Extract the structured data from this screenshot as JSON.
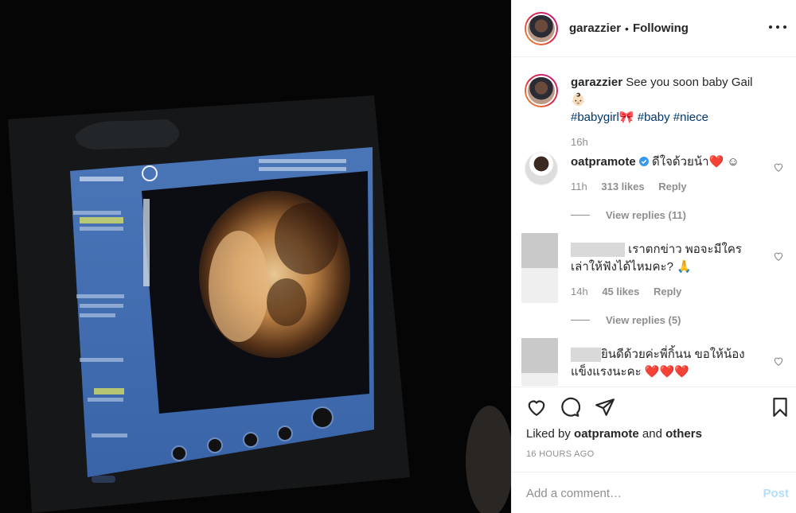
{
  "post": {
    "username": "garazzier",
    "separator": "•",
    "follow_status": "Following"
  },
  "caption": {
    "username": "garazzier",
    "text": "See you soon baby Gail",
    "emoji": "👶🏻",
    "hashtags": [
      "#babygirl",
      "🎀",
      "#baby",
      "#niece"
    ],
    "time": "16h"
  },
  "comments": [
    {
      "username": "oatpramote",
      "verified": true,
      "text": "ดีใจด้วยน้า",
      "emoji": "❤️ ☺",
      "time": "11h",
      "likes": "313 likes",
      "reply": "Reply",
      "view_replies": "View replies (11)"
    },
    {
      "username": "",
      "text_line1": "เราตกข่าว พอจะมีใคร",
      "text_line2": "เล่าให้ฟังได้ไหมคะ?",
      "emoji": "🙏",
      "time": "14h",
      "likes": "45 likes",
      "reply": "Reply",
      "view_replies": "View replies (5)"
    },
    {
      "username": "",
      "text_line1": "ยินดีด้วยค่ะพี่กิ้นน ขอให้น้อง",
      "text_line2": "แข็งแรงนะคะ",
      "emoji": "❤️❤️❤️"
    }
  ],
  "footer": {
    "liked_prefix": "Liked by",
    "liked_user": "oatpramote",
    "liked_and": "and",
    "liked_others": "others",
    "timestamp": "16 HOURS AGO",
    "comment_placeholder": "Add a comment…",
    "post_label": "Post"
  },
  "icons": [
    "more-icon",
    "heart-icon",
    "comment-icon",
    "share-icon",
    "bookmark-icon",
    "verified-badge-icon"
  ],
  "colors": {
    "link": "#00376b",
    "muted": "#8e8e8e",
    "verified": "#3897f0",
    "post_disabled": "#b2dffc"
  }
}
